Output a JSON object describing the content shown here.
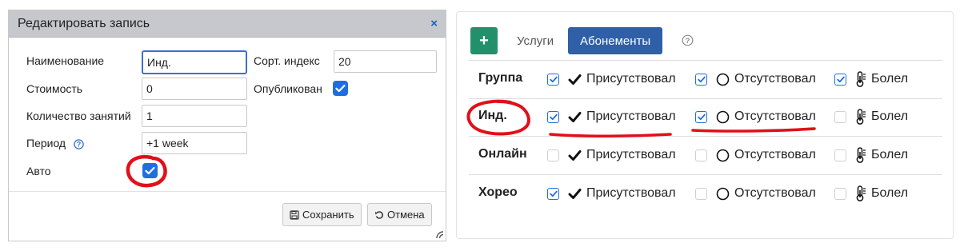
{
  "dialog": {
    "title": "Редактировать запись",
    "close_label": "×",
    "fields": {
      "name_label": "Наименование",
      "name_value": "Инд.",
      "cost_label": "Стоимость",
      "cost_value": "0",
      "lessons_label": "Количество занятий",
      "lessons_value": "1",
      "period_label": "Период",
      "period_value": "+1 week",
      "auto_label": "Авто",
      "auto_checked": true,
      "sort_label": "Сорт. индекс",
      "sort_value": "20",
      "published_label": "Опубликован",
      "published_checked": true
    },
    "save_label": "Сохранить",
    "cancel_label": "Отмена"
  },
  "panel": {
    "add_label": "+",
    "tabs": [
      {
        "label": "Услуги",
        "active": false
      },
      {
        "label": "Абонементы",
        "active": true
      }
    ],
    "status_labels": {
      "present": "Присутствовал",
      "absent": "Отсутствовал",
      "sick": "Болел"
    },
    "rows": [
      {
        "name": "Группа",
        "present": true,
        "absent": true,
        "sick": true
      },
      {
        "name": "Инд.",
        "present": true,
        "absent": true,
        "sick": false
      },
      {
        "name": "Онлайн",
        "present": false,
        "absent": false,
        "sick": false
      },
      {
        "name": "Хорео",
        "present": true,
        "absent": false,
        "sick": false
      }
    ]
  },
  "colors": {
    "accent_blue": "#1f6ee0",
    "tab_active": "#2f5fa7",
    "add_green": "#22906b",
    "annotation_red": "#e0101a"
  }
}
